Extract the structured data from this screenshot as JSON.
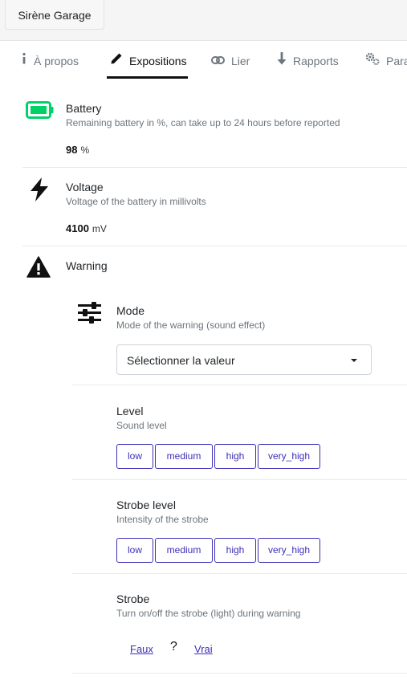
{
  "header": {
    "device_name": "Sirène Garage"
  },
  "tabs": [
    {
      "label": "À propos",
      "icon": "info-icon"
    },
    {
      "label": "Expositions",
      "icon": "pencil-icon",
      "active": true
    },
    {
      "label": "Lier",
      "icon": "link-icon"
    },
    {
      "label": "Rapports",
      "icon": "arrow-down-icon"
    },
    {
      "label": "Para",
      "icon": "gears-icon"
    }
  ],
  "features": {
    "battery": {
      "title": "Battery",
      "description": "Remaining battery in %, can take up to 24 hours before reported",
      "value": "98",
      "unit": "%",
      "icon": "battery-icon",
      "icon_color": "#00d26a"
    },
    "voltage": {
      "title": "Voltage",
      "description": "Voltage of the battery in millivolts",
      "value": "4100",
      "unit": "mV",
      "icon": "bolt-icon"
    },
    "warning": {
      "title": "Warning",
      "icon": "warning-icon",
      "mode": {
        "title": "Mode",
        "description": "Mode of the warning (sound effect)",
        "select_value": "Sélectionner la valeur",
        "icon": "sliders-icon"
      },
      "level": {
        "title": "Level",
        "description": "Sound level",
        "options": [
          "low",
          "medium",
          "high",
          "very_high"
        ]
      },
      "strobe_level": {
        "title": "Strobe level",
        "description": "Intensity of the strobe",
        "options": [
          "low",
          "medium",
          "high",
          "very_high"
        ]
      },
      "strobe": {
        "title": "Strobe",
        "description": "Turn on/off the strobe (light) during warning",
        "false_label": "Faux",
        "unknown_label": "?",
        "true_label": "Vrai"
      }
    }
  },
  "colors": {
    "accent": "#3c2fb5",
    "battery_green": "#00d26a"
  }
}
